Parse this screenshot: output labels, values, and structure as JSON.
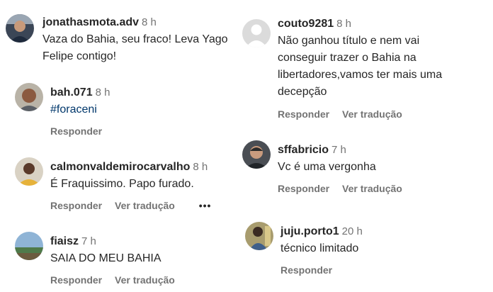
{
  "comments": [
    {
      "username": "jonathasmota.adv",
      "time": "8 h",
      "text": "Vaza do Bahia, seu fraco! Leva Yago\nFelipe contigo!",
      "avatar": "profile-photo"
    },
    {
      "username": "bah.071",
      "time": "8 h",
      "text": "#foraceni",
      "reply": "Responder",
      "avatar": "profile-photo"
    },
    {
      "username": "calmonvaldemirocarvalho",
      "time": "8 h",
      "text": "É Fraquissimo. Papo furado.",
      "reply": "Responder",
      "translate": "Ver tradução",
      "more": "•••",
      "avatar": "profile-photo"
    },
    {
      "username": "fiaisz",
      "time": "7 h",
      "text": "SAIA DO MEU BAHIA",
      "reply": "Responder",
      "translate": "Ver tradução",
      "avatar": "landscape-photo"
    },
    {
      "username": "couto9281",
      "time": "8 h",
      "text": "Não ganhou título e nem vai\nconseguir trazer o Bahia na\nlibertadores,vamos ter mais uma\ndecepção",
      "reply": "Responder",
      "translate": "Ver tradução",
      "avatar": "default-avatar"
    },
    {
      "username": "sffabricio",
      "time": "7 h",
      "text": "Vc é uma vergonha",
      "reply": "Responder",
      "translate": "Ver tradução",
      "avatar": "profile-photo"
    },
    {
      "username": "juju.porto1",
      "time": "20 h",
      "text": "técnico limitado",
      "reply": "Responder",
      "avatar": "profile-photo"
    }
  ],
  "colors": {
    "username": "#262626",
    "secondary": "#737373",
    "hashtag": "#00376b"
  }
}
